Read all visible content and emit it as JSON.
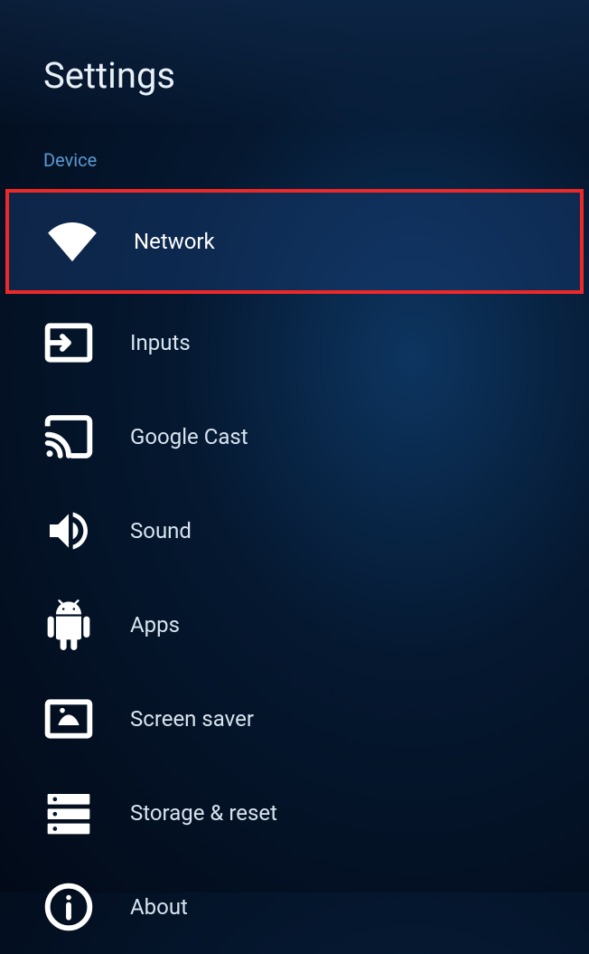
{
  "header": {
    "title": "Settings"
  },
  "section": {
    "label": "Device"
  },
  "menu": {
    "items": [
      {
        "label": "Network"
      },
      {
        "label": "Inputs"
      },
      {
        "label": "Google Cast"
      },
      {
        "label": "Sound"
      },
      {
        "label": "Apps"
      },
      {
        "label": "Screen saver"
      },
      {
        "label": "Storage & reset"
      },
      {
        "label": "About"
      }
    ]
  }
}
